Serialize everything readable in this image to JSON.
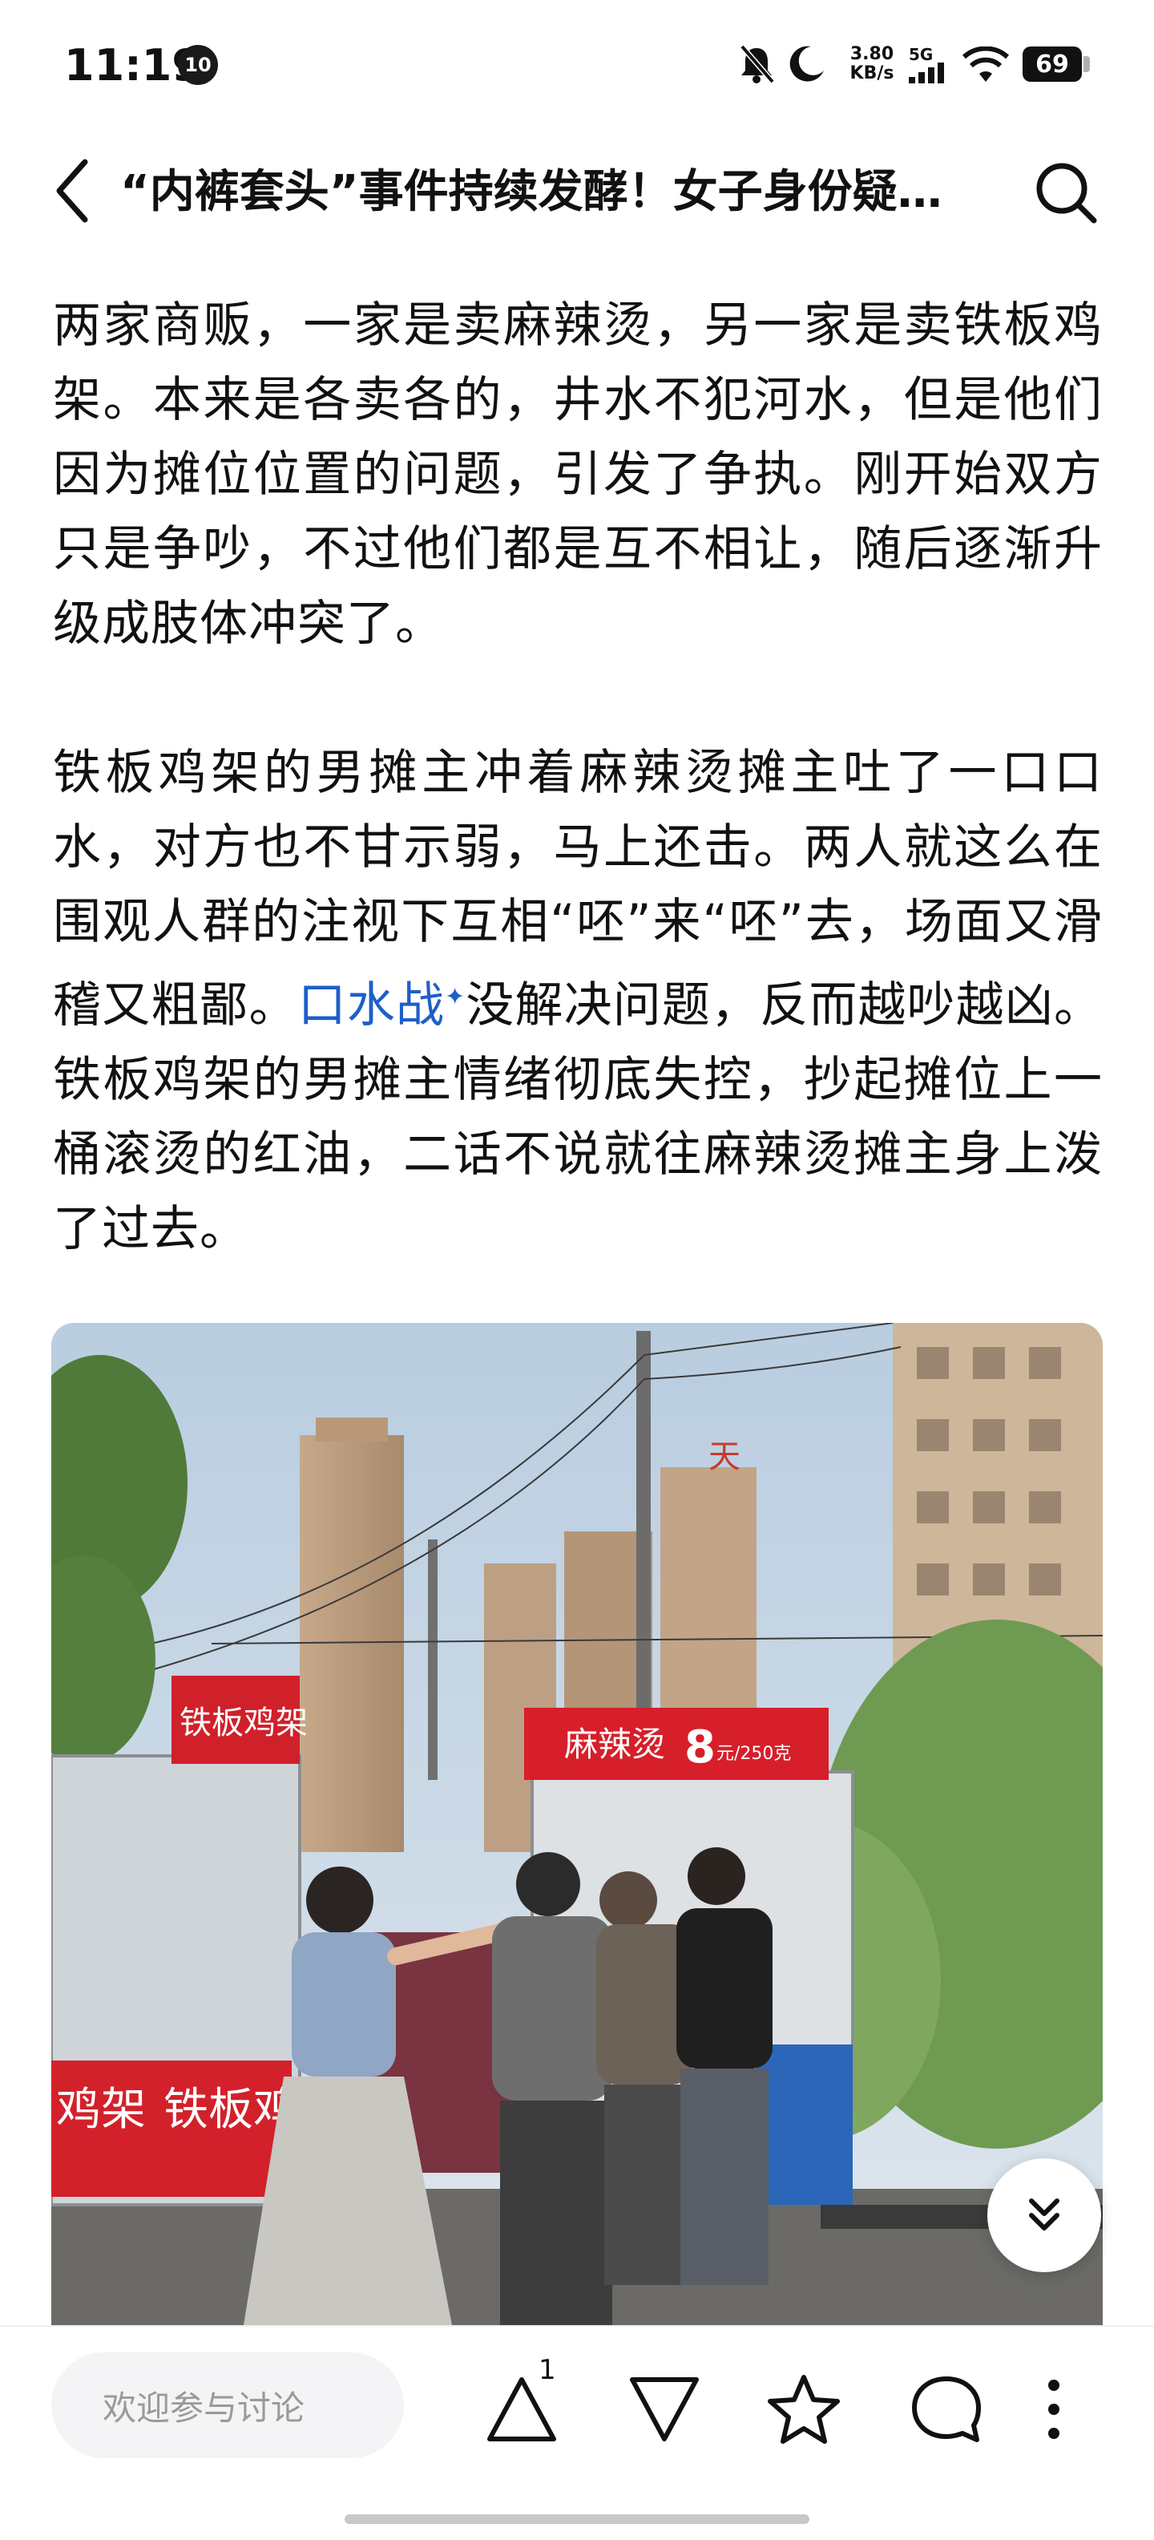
{
  "status_bar": {
    "time": "11:19",
    "notification_count": "10",
    "net_speed_value": "3.80",
    "net_speed_unit": "KB/s",
    "network_type": "5G",
    "battery": "69",
    "icons": [
      "mute-icon",
      "moon-icon",
      "signal-icon",
      "wifi-icon",
      "battery-icon"
    ]
  },
  "header": {
    "title": "“内裤套头”事件持续发酵！女子身份疑…",
    "back_icon": "back-chevron-icon",
    "search_icon": "search-icon"
  },
  "article": {
    "paragraph1": "两家商贩，一家是卖麻辣烫，另一家是卖铁板鸡架。本来是各卖各的，井水不犯河水，但是他们因为摊位位置的问题，引发了争执。刚开始双方只是争吵，不过他们都是互不相让，随后逐渐升级成肢体冲突了。",
    "paragraph2_before_link": "铁板鸡架的男摊主冲着麻辣烫摊主吐了一口口水，对方也不甘示弱，马上还击。两人就这么在围观人群的注视下互相“呸”来“呸”去，场面又滑稽又粗鄙。",
    "paragraph2_link": "口水战",
    "paragraph2_link_mark": "✦",
    "paragraph2_after_link": "没解决问题，反而越吵越凶。铁板鸡架的男摊主情绪彻底失控，抄起摊位上一桶滚烫的红油，二话不说就往麻辣烫摊主身上泼了过去。",
    "link_color": "#1e5fc8"
  },
  "photo": {
    "sign_left": "铁板鸡架",
    "sign_center": "麻辣烫",
    "sign_center_price": "8",
    "sign_center_unit": "元/250克",
    "banner_left_1": "鸡架",
    "banner_left_2": "铁板鸡",
    "building_char": "天"
  },
  "bottom_bar": {
    "comment_placeholder": "欢迎参与讨论",
    "upvote_count": "1",
    "icons": [
      "upvote-icon",
      "downvote-icon",
      "star-icon",
      "comment-icon",
      "more-icon"
    ]
  },
  "colors": {
    "text": "#111111",
    "link": "#1e5fc8",
    "input_bg": "#f4f4f6",
    "placeholder": "#9a9a9a"
  }
}
